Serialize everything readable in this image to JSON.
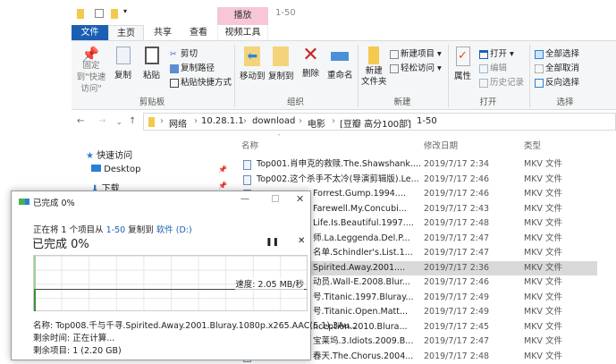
{
  "quick_access": {
    "title": "1-50"
  },
  "context_tab": "播放",
  "tabs": [
    "文件",
    "主页",
    "共享",
    "查看",
    "视频工具"
  ],
  "ribbon": {
    "clipboard": {
      "pin": "固定到\"快速访问\"",
      "copy": "复制",
      "paste": "粘贴",
      "cut": "剪切",
      "copy_path": "复制路径",
      "paste_shortcut": "粘贴快捷方式",
      "label": "剪贴板"
    },
    "organize": {
      "move_to": "移动到",
      "copy_to": "复制到",
      "delete": "删除",
      "rename": "重命名",
      "label": "组织"
    },
    "new": {
      "new_folder": "新建\n文件夹",
      "new_item": "新建项目 ▾",
      "easy_access": "轻松访问 ▾",
      "label": "新建"
    },
    "open": {
      "properties": "属性",
      "open": "打开 ▾",
      "edit": "编辑",
      "history": "历史记录",
      "label": "打开"
    },
    "select": {
      "select_all": "全部选择",
      "select_none": "全部取消",
      "invert": "反向选择",
      "label": "选择"
    }
  },
  "breadcrumb": [
    "网络",
    "10.28.1.1",
    "download",
    "电影",
    "[豆瓣 高分100部]",
    "1-50"
  ],
  "nav": {
    "quick_access": "快速访问",
    "desktop": "Desktop",
    "downloads": "下载"
  },
  "columns": {
    "name": "名称",
    "date": "修改日期",
    "type": "类型"
  },
  "files": [
    {
      "name": "Top001.肖申克的救赎.The.Shawshank....",
      "date": "2019/7/17 2:34",
      "type": "MKV 文件"
    },
    {
      "name": "Top002.这个杀手不太冷(导演剪辑版).Le...",
      "date": "2019/7/17 2:46",
      "type": "MKV 文件"
    },
    {
      "name": "Forrest.Gump.1994....",
      "date": "2019/7/17 2:46",
      "type": "MKV 文件"
    },
    {
      "name": "Farewell.My.Concubi...",
      "date": "2019/7/17 2:43",
      "type": "MKV 文件"
    },
    {
      "name": "Life.Is.Beautiful.1997....",
      "date": "2019/7/17 2:48",
      "type": "MKV 文件"
    },
    {
      "name": "师.La.Leggenda.Del.P...",
      "date": "2019/7/17 2:47",
      "type": "MKV 文件"
    },
    {
      "name": "名单.Schindler's.List.1...",
      "date": "2019/7/17 2:47",
      "type": "MKV 文件"
    },
    {
      "name": "Spirited.Away.2001....",
      "date": "2019/7/17 2:36",
      "type": "MKV 文件"
    },
    {
      "name": "动员.Wall-E.2008.Blur...",
      "date": "2019/7/17 2:46",
      "type": "MKV 文件"
    },
    {
      "name": "号.Titanic.1997.Bluray...",
      "date": "2019/7/17 2:49",
      "type": "MKV 文件"
    },
    {
      "name": "号.Titanic.Open.Matt...",
      "date": "2019/7/17 2:49",
      "type": "MKV 文件"
    },
    {
      "name": "nception.2010.Blura...",
      "date": "2019/7/17 2:45",
      "type": "MKV 文件"
    },
    {
      "name": "宝莱坞.3.Idiots.2009.B...",
      "date": "2019/7/17 2:47",
      "type": "MKV 文件"
    },
    {
      "name": "春天.The.Chorus.2004...",
      "date": "2019/7/17 2:48",
      "type": "MKV 文件"
    }
  ],
  "dialog": {
    "title": "已完成 0%",
    "desc_prefix": "正在将 1 个项目从 ",
    "source": "1-50",
    "desc_mid": " 复制到 ",
    "dest": "软件 (D:)",
    "progress_text": "已完成 0%",
    "progress": 0,
    "speed": "速度: 2.05 MB/秒",
    "name_line": "名称: Top008.千与千寻.Spirited.Away.2001.Bluray.1080p.x265.AAC(5.1).3Au...",
    "time_left": "剩余时间: 正在计算...",
    "items_left": "剩余项目: 1 (2.20 GB)"
  }
}
